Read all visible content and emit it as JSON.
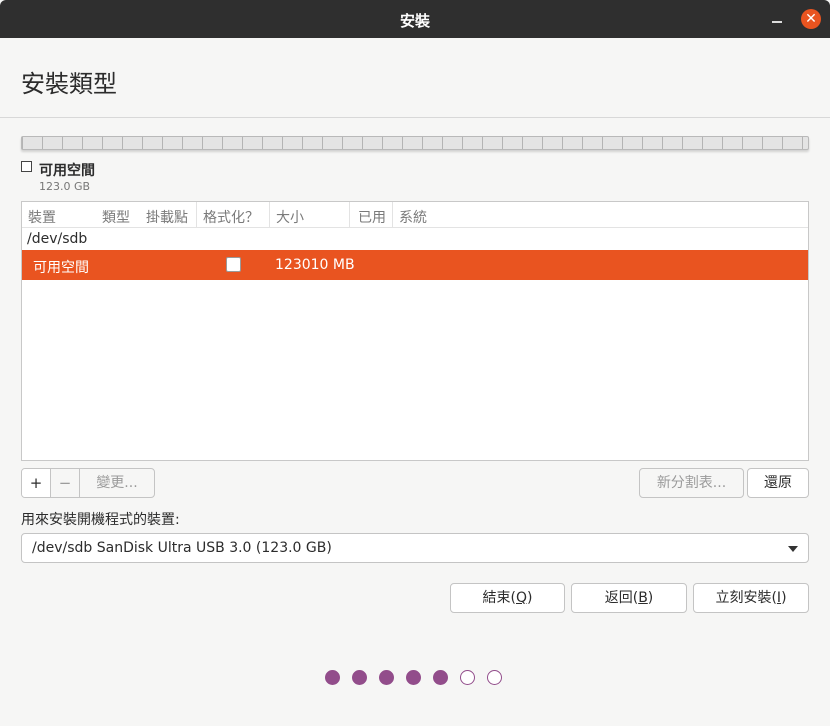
{
  "window": {
    "title": "安裝",
    "minimize_glyph": "",
    "close_glyph": "✕"
  },
  "header": {
    "title": "安裝類型"
  },
  "legend": {
    "label": "可用空間",
    "size": "123.0 GB"
  },
  "table": {
    "columns": [
      "裝置",
      "類型",
      "掛載點",
      "格式化？",
      "大小",
      "已用",
      "系統"
    ],
    "group": "/dev/sdb",
    "rows": [
      {
        "device": "可用空間",
        "format_checked": false,
        "size": "123010 MB"
      }
    ]
  },
  "toolbar": {
    "add": "+",
    "remove": "−",
    "change": "變更...",
    "new_table": "新分割表...",
    "revert": "還原"
  },
  "boot": {
    "label": "用來安裝開機程式的裝置:",
    "selected": "/dev/sdb SanDisk Ultra USB 3.0 (123.0 GB)"
  },
  "buttons": {
    "quit": {
      "text": "結束(",
      "key": "Q",
      "end": ")"
    },
    "back": {
      "text": "返回(",
      "key": "B",
      "end": ")"
    },
    "install": {
      "text": "立刻安裝(",
      "key": "I",
      "end": ")"
    }
  },
  "progress": {
    "total_steps": 7,
    "completed_steps": 5,
    "accent": "#924d8b"
  },
  "colors": {
    "selection": "#e95420",
    "titlebar": "#2f2f2f"
  }
}
